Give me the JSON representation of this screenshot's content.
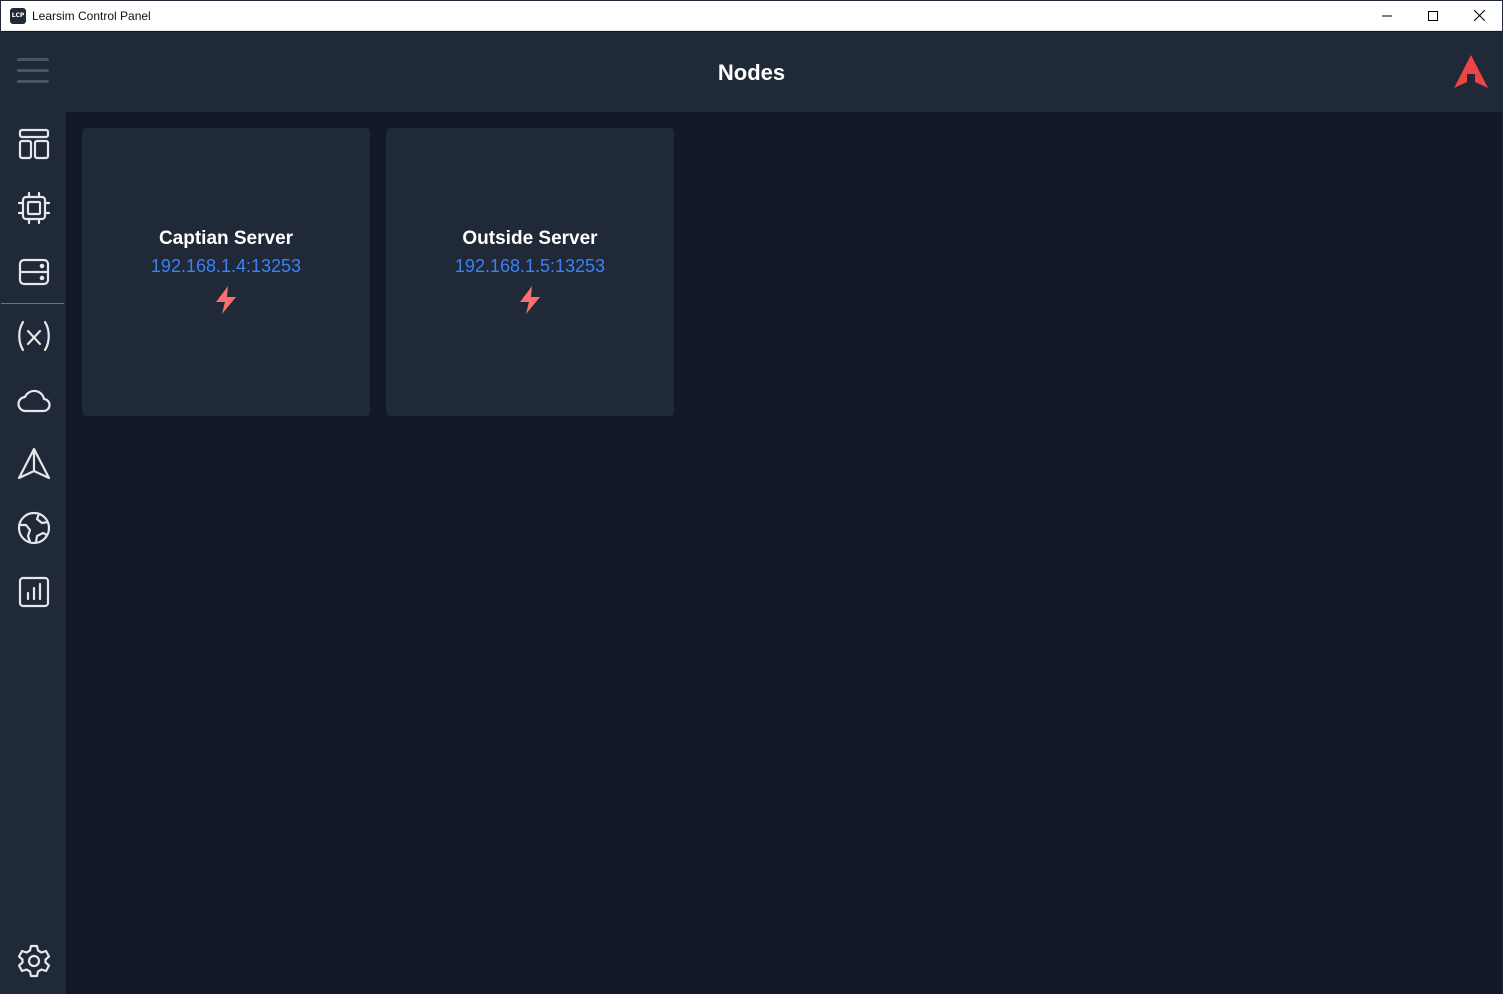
{
  "window": {
    "app_icon_text": "LCP",
    "title": "Learsim Control Panel",
    "controls": [
      "minimize",
      "maximize",
      "close"
    ]
  },
  "header": {
    "title": "Nodes",
    "menu_icon": "hamburger-menu-icon",
    "logo_icon": "learsim-logo-icon",
    "logo_color": "#ef4444"
  },
  "sidebar": {
    "items": [
      {
        "name": "dashboard",
        "icon": "layout-icon"
      },
      {
        "name": "nodes",
        "icon": "chip-icon"
      },
      {
        "name": "servers",
        "icon": "server-icon"
      },
      {
        "name": "variables",
        "icon": "variable-icon"
      },
      {
        "name": "weather",
        "icon": "cloud-icon"
      },
      {
        "name": "navigation",
        "icon": "navigation-icon"
      },
      {
        "name": "world",
        "icon": "globe-icon"
      },
      {
        "name": "statistics",
        "icon": "chart-icon"
      }
    ],
    "bottom_item": {
      "name": "settings",
      "icon": "gear-icon"
    }
  },
  "nodes": [
    {
      "name": "Captian Server",
      "address": "192.168.1.4:13253",
      "status_icon": "bolt-icon"
    },
    {
      "name": "Outside Server",
      "address": "192.168.1.5:13253",
      "status_icon": "bolt-icon"
    }
  ],
  "colors": {
    "background": "#111827",
    "panel": "#1f2937",
    "accent_link": "#3b82f6",
    "status_bolt": "#f87171",
    "icon_stroke": "#e5e7eb"
  }
}
